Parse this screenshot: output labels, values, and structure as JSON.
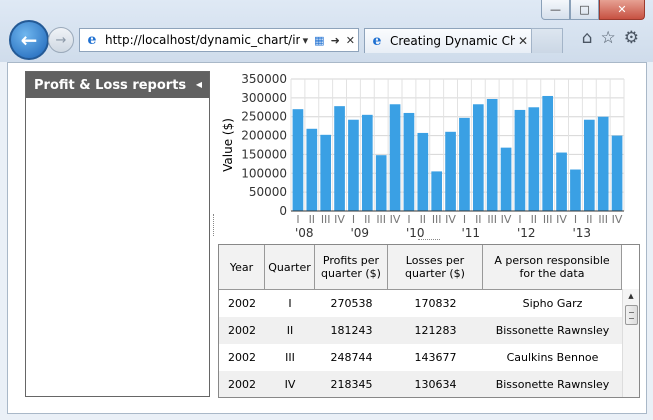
{
  "browser": {
    "address": "http://localhost/dynamic_chart/in",
    "tab_title": "Creating Dynamic Ch...",
    "colors": {
      "accent": "#1c63b7",
      "bar": "#3aa0e4",
      "sidebar_header": "#616161"
    }
  },
  "sidebar": {
    "title": "Profit & Loss reports"
  },
  "chart_data": {
    "type": "bar",
    "ylabel": "Value ($)",
    "ylim": [
      0,
      350000
    ],
    "yticks": [
      "0",
      "50000",
      "100000",
      "150000",
      "200000",
      "250000",
      "300000",
      "350000"
    ],
    "categories": [
      "I",
      "II",
      "III",
      "IV",
      "I",
      "II",
      "III",
      "IV",
      "I",
      "II",
      "III",
      "IV",
      "I",
      "II",
      "III",
      "IV",
      "I",
      "II",
      "III",
      "IV",
      "I",
      "II",
      "III",
      "IV"
    ],
    "year_labels": [
      "'08",
      "'09",
      "'10",
      "'11",
      "'12",
      "'13"
    ],
    "values": [
      270000,
      218000,
      202000,
      278000,
      242000,
      255000,
      148000,
      283000,
      260000,
      207000,
      105000,
      210000,
      247000,
      283000,
      297000,
      168000,
      268000,
      275000,
      305000,
      155000,
      110000,
      242000,
      250000,
      200000
    ],
    "grid": true
  },
  "table": {
    "columns": [
      "Year",
      "Quarter",
      "Profits per quarter ($)",
      "Losses per quarter ($)",
      "A person responsible for the data"
    ],
    "rows": [
      [
        "2002",
        "I",
        "270538",
        "170832",
        "Sipho Garz"
      ],
      [
        "2002",
        "II",
        "181243",
        "121283",
        "Bissonette Rawnsley"
      ],
      [
        "2002",
        "III",
        "248744",
        "143677",
        "Caulkins Bennoe"
      ],
      [
        "2002",
        "IV",
        "218345",
        "130634",
        "Bissonette Rawnsley"
      ]
    ]
  }
}
